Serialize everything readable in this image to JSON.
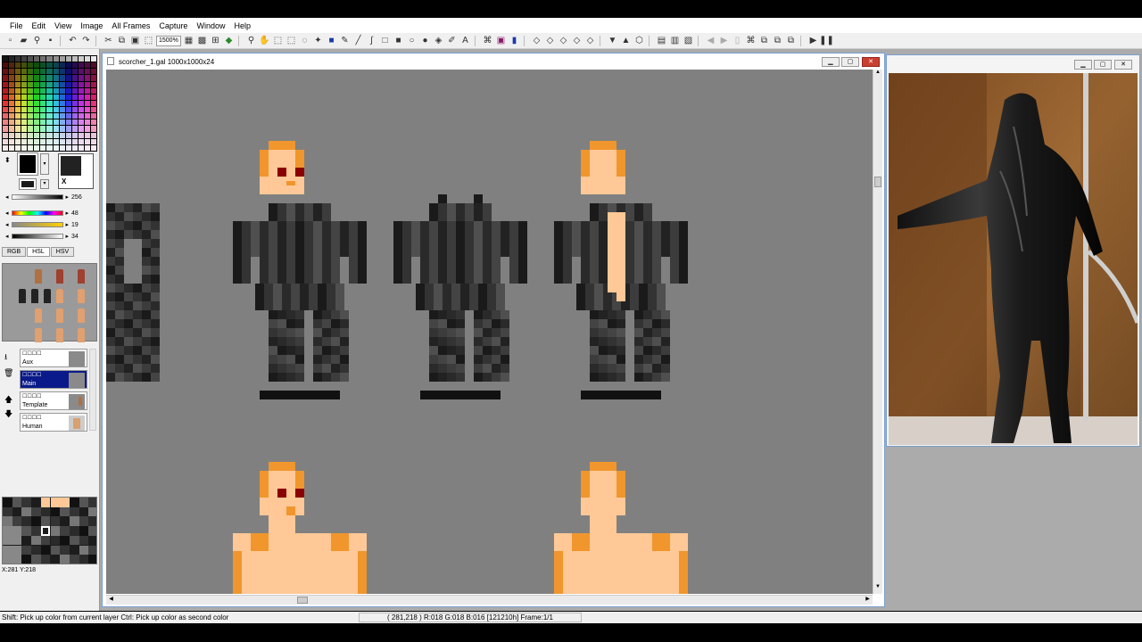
{
  "menu": [
    "File",
    "Edit",
    "View",
    "Image",
    "All Frames",
    "Capture",
    "Window",
    "Help"
  ],
  "toolbar": {
    "zoom": "1500%"
  },
  "colors": {
    "accent": "#0a1a8a",
    "skin": "#ffc896",
    "skin_edge": "#f0962d",
    "eye": "#8b0000",
    "armor": "#2a2a2a",
    "canvas_bg": "#808080"
  },
  "color_picker": {
    "primary_color": "#000000",
    "secondary_color": "#222222",
    "secondary_marker": "X",
    "values": [
      "256",
      "48",
      "19",
      "34"
    ]
  },
  "tabs": [
    "RGB",
    "HSL",
    "HSV"
  ],
  "layers": [
    {
      "name": "Aux"
    },
    {
      "name": "Main",
      "selected": true
    },
    {
      "name": "Template"
    },
    {
      "name": "Human"
    }
  ],
  "coords": "X:281 Y:218",
  "document": {
    "title": "scorcher_1.gal  1000x1000x24"
  },
  "status": {
    "hint": "Shift: Pick up color from current layer  Ctrl: Pick up color as second color",
    "pixel_info": "( 281,218 ) R:018 G:018 B:016  [121210h]  Frame:1/1"
  }
}
